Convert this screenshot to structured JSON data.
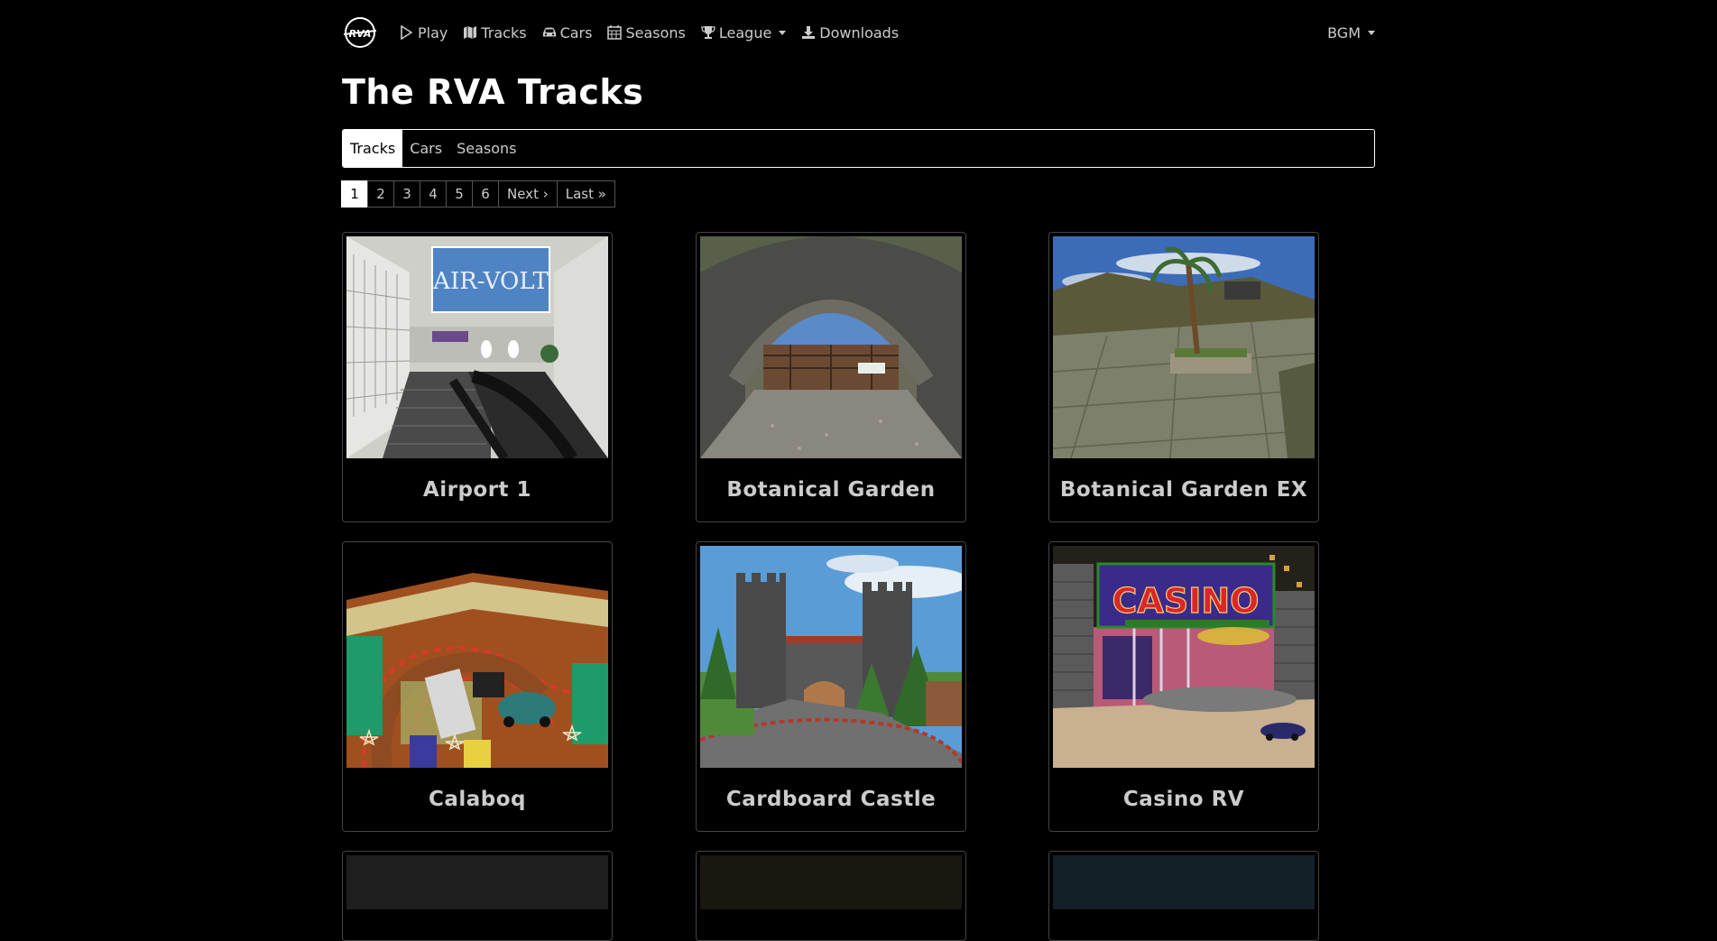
{
  "nav": {
    "items": [
      {
        "label": "Play",
        "icon": "play-icon"
      },
      {
        "label": "Tracks",
        "icon": "map-icon"
      },
      {
        "label": "Cars",
        "icon": "car-icon"
      },
      {
        "label": "Seasons",
        "icon": "calendar-icon"
      },
      {
        "label": "League",
        "icon": "trophy-icon"
      },
      {
        "label": "Downloads",
        "icon": "download-icon"
      }
    ],
    "right_label": "BGM"
  },
  "page": {
    "title": "The RVA Tracks"
  },
  "tabs": [
    {
      "label": "Tracks",
      "active": true
    },
    {
      "label": "Cars",
      "active": false
    },
    {
      "label": "Seasons",
      "active": false
    }
  ],
  "pagination": {
    "pages": [
      "1",
      "2",
      "3",
      "4",
      "5",
      "6"
    ],
    "current": "1",
    "next_label": "Next ›",
    "last_label": "Last »"
  },
  "tracks": [
    {
      "name": "Airport 1"
    },
    {
      "name": "Botanical Garden"
    },
    {
      "name": "Botanical Garden EX"
    },
    {
      "name": "Calaboq"
    },
    {
      "name": "Cardboard Castle"
    },
    {
      "name": "Casino RV"
    }
  ],
  "thumb_texts": {
    "airport_sign": "AIR-VOLT",
    "casino_sign": "CASINO"
  },
  "colors": {
    "background": "#000000",
    "text": "#cccccc",
    "active_tab_bg": "#ffffff"
  }
}
